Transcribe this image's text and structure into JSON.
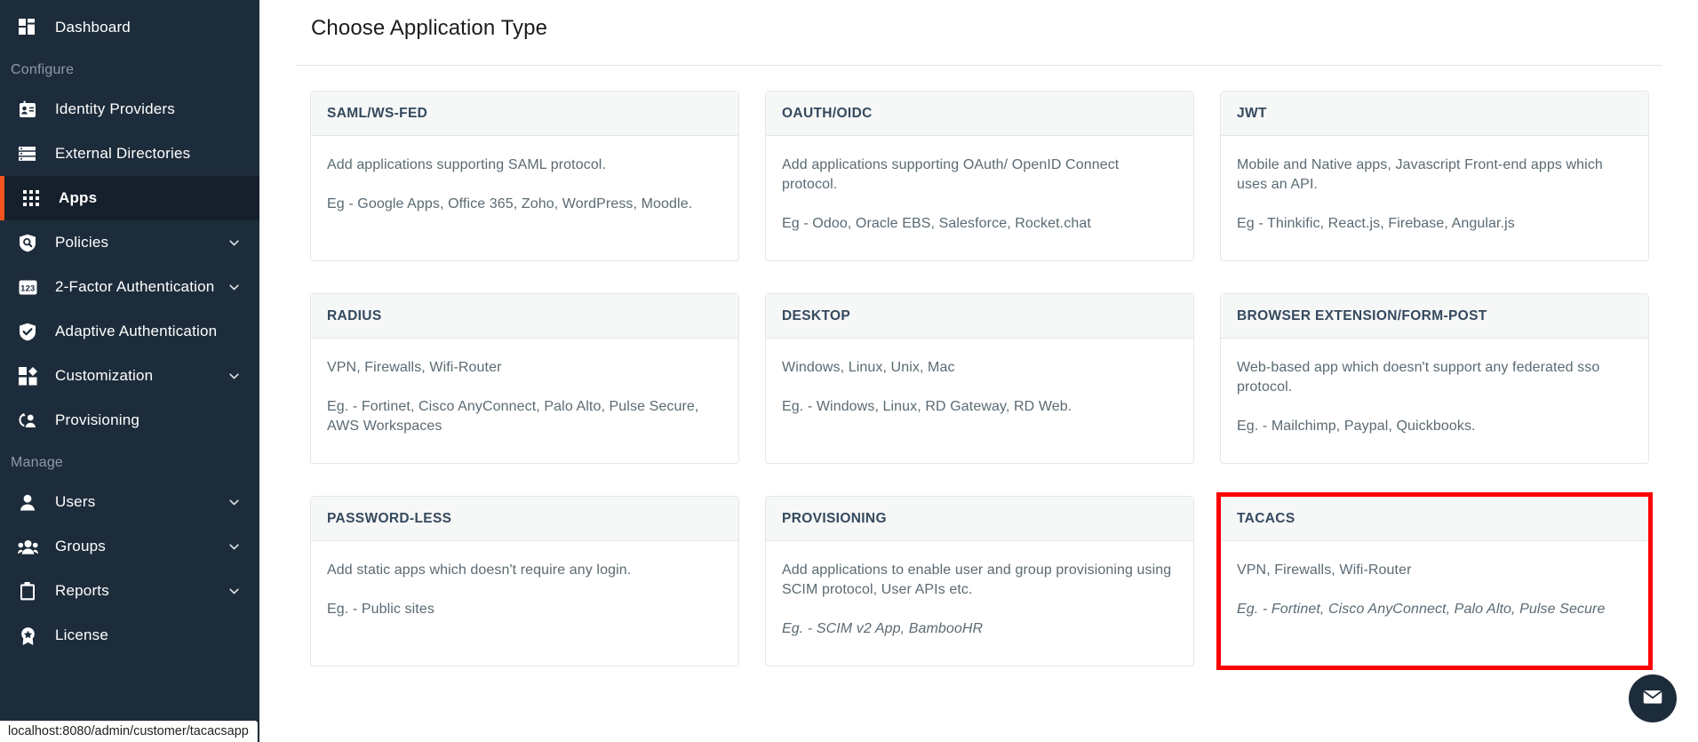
{
  "sidebar": {
    "items": [
      {
        "label": "Dashboard",
        "icon": "dashboard-icon",
        "active": false,
        "chevron": false
      },
      {
        "label": "Identity Providers",
        "icon": "id-card-icon",
        "active": false,
        "chevron": false
      },
      {
        "label": "External Directories",
        "icon": "list-rows-icon",
        "active": false,
        "chevron": false
      },
      {
        "label": "Apps",
        "icon": "grid-dots-icon",
        "active": true,
        "chevron": false
      },
      {
        "label": "Policies",
        "icon": "shield-search-icon",
        "active": false,
        "chevron": true
      },
      {
        "label": "2-Factor Authentication",
        "icon": "numeric-123-icon",
        "active": false,
        "chevron": true
      },
      {
        "label": "Adaptive Authentication",
        "icon": "shield-check-icon",
        "active": false,
        "chevron": false
      },
      {
        "label": "Customization",
        "icon": "customize-icon",
        "active": false,
        "chevron": true
      },
      {
        "label": "Provisioning",
        "icon": "provisioning-icon",
        "active": false,
        "chevron": false
      },
      {
        "label": "Users",
        "icon": "user-icon",
        "active": false,
        "chevron": true
      },
      {
        "label": "Groups",
        "icon": "users-group-icon",
        "active": false,
        "chevron": true
      },
      {
        "label": "Reports",
        "icon": "clipboard-icon",
        "active": false,
        "chevron": true
      },
      {
        "label": "License",
        "icon": "badge-star-icon",
        "active": false,
        "chevron": false
      }
    ],
    "section_configure": "Configure",
    "section_manage": "Manage"
  },
  "statusbar": {
    "url": "localhost:8080/admin/customer/tacacsapp"
  },
  "main": {
    "title": "Choose Application Type",
    "cards": [
      {
        "title": "SAML/WS-FED",
        "desc": "Add applications supporting SAML protocol.",
        "eg": "Eg - Google Apps, Office 365, Zoho, WordPress, Moodle.",
        "eg_italic": false,
        "highlight": false
      },
      {
        "title": "OAUTH/OIDC",
        "desc": "Add applications supporting OAuth/ OpenID Connect protocol.",
        "eg": "Eg - Odoo, Oracle EBS, Salesforce, Rocket.chat",
        "eg_italic": false,
        "highlight": false
      },
      {
        "title": "JWT",
        "desc": "Mobile and Native apps, Javascript Front-end apps which uses an API.",
        "eg": "Eg - Thinkific, React.js, Firebase, Angular.js",
        "eg_italic": false,
        "highlight": false
      },
      {
        "title": "RADIUS",
        "desc": "VPN, Firewalls, Wifi-Router",
        "eg": "Eg. - Fortinet, Cisco AnyConnect, Palo Alto, Pulse Secure, AWS Workspaces",
        "eg_italic": false,
        "highlight": false
      },
      {
        "title": "DESKTOP",
        "desc": "Windows, Linux, Unix, Mac",
        "eg": "Eg. - Windows, Linux, RD Gateway, RD Web.",
        "eg_italic": false,
        "highlight": false
      },
      {
        "title": "BROWSER EXTENSION/FORM-POST",
        "desc": "Web-based app which doesn't support any federated sso protocol.",
        "eg": "Eg. - Mailchimp, Paypal, Quickbooks.",
        "eg_italic": false,
        "highlight": false
      },
      {
        "title": "PASSWORD-LESS",
        "desc": "Add static apps which doesn't require any login.",
        "eg": "Eg. - Public sites",
        "eg_italic": false,
        "highlight": false
      },
      {
        "title": "PROVISIONING",
        "desc": "Add applications to enable user and group provisioning using SCIM protocol, User APIs etc.",
        "eg": "Eg. - SCIM v2 App, BambooHR",
        "eg_italic": true,
        "highlight": false
      },
      {
        "title": "TACACS",
        "desc": "VPN, Firewalls, Wifi-Router",
        "eg": "Eg. - Fortinet, Cisco AnyConnect, Palo Alto, Pulse Secure",
        "eg_italic": true,
        "highlight": true
      }
    ]
  },
  "chat": {
    "icon": "envelope-icon"
  },
  "colors": {
    "sidebar_bg": "#1d2c3b",
    "sidebar_active_bg": "#16202c",
    "accent_orange": "#f4511e",
    "highlight_red": "#fe0000",
    "card_head_bg": "#f6f7f7",
    "card_border": "#e4e6e8",
    "heading_text": "#34495e",
    "body_text": "#5b6a73"
  }
}
